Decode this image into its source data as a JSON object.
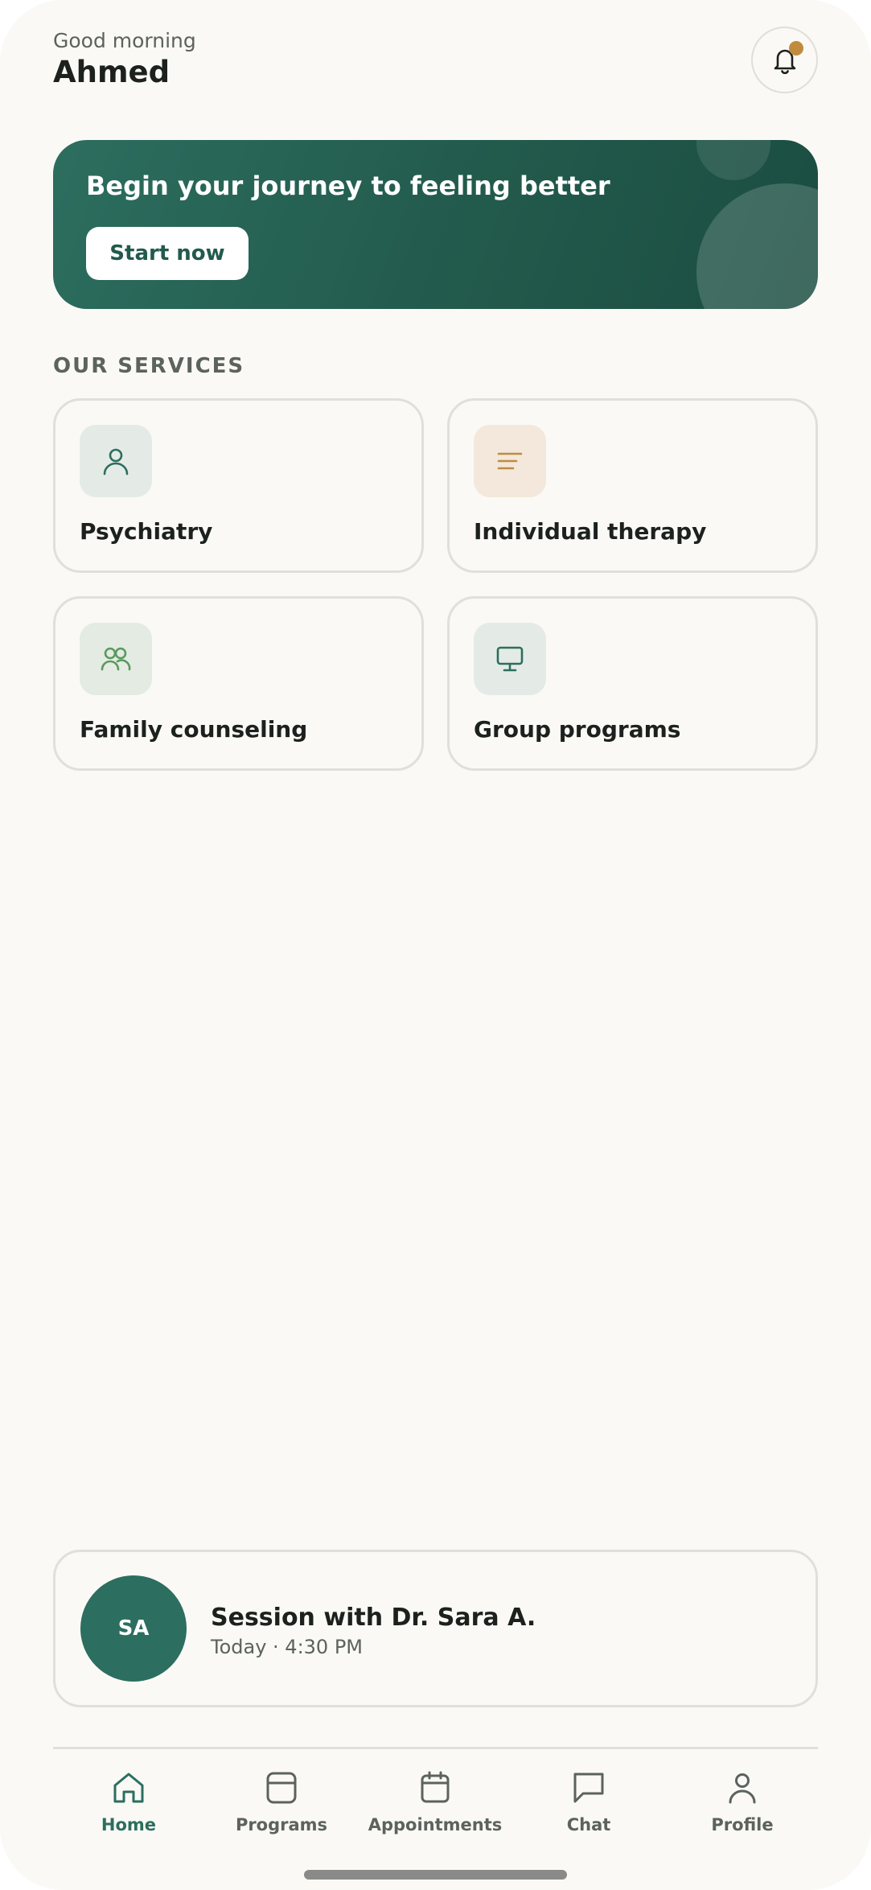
{
  "header": {
    "greeting": "Good morning",
    "username": "Ahmed",
    "notification_icon": "bell-icon",
    "has_unread": true
  },
  "hero": {
    "title": "Begin your journey to feeling better",
    "button_label": "Start now"
  },
  "services": {
    "section_title": "OUR SERVICES",
    "items": [
      {
        "label": "Psychiatry",
        "icon": "person-icon",
        "icon_color": "#2c6e5f",
        "icon_bg": "#e4ebe7"
      },
      {
        "label": "Individual therapy",
        "icon": "lines-icon",
        "icon_color": "#c08b3f",
        "icon_bg": "#f3e8db"
      },
      {
        "label": "Family counseling",
        "icon": "people-icon",
        "icon_color": "#5a9a5f",
        "icon_bg": "#e4ebe2"
      },
      {
        "label": "Group programs",
        "icon": "monitor-icon",
        "icon_color": "#2c6e5f",
        "icon_bg": "#e4ebe7"
      }
    ]
  },
  "session": {
    "avatar_initials": "SA",
    "title": "Session with Dr. Sara A.",
    "time": "Today · 4:30 PM"
  },
  "nav": {
    "items": [
      {
        "label": "Home",
        "icon": "home-icon",
        "active": true
      },
      {
        "label": "Programs",
        "icon": "programs-icon",
        "active": false
      },
      {
        "label": "Appointments",
        "icon": "calendar-icon",
        "active": false
      },
      {
        "label": "Chat",
        "icon": "chat-icon",
        "active": false
      },
      {
        "label": "Profile",
        "icon": "profile-icon",
        "active": false
      }
    ]
  },
  "colors": {
    "brand": "#2c6e5f",
    "accent": "#c08b3f",
    "background": "#faf9f6"
  }
}
